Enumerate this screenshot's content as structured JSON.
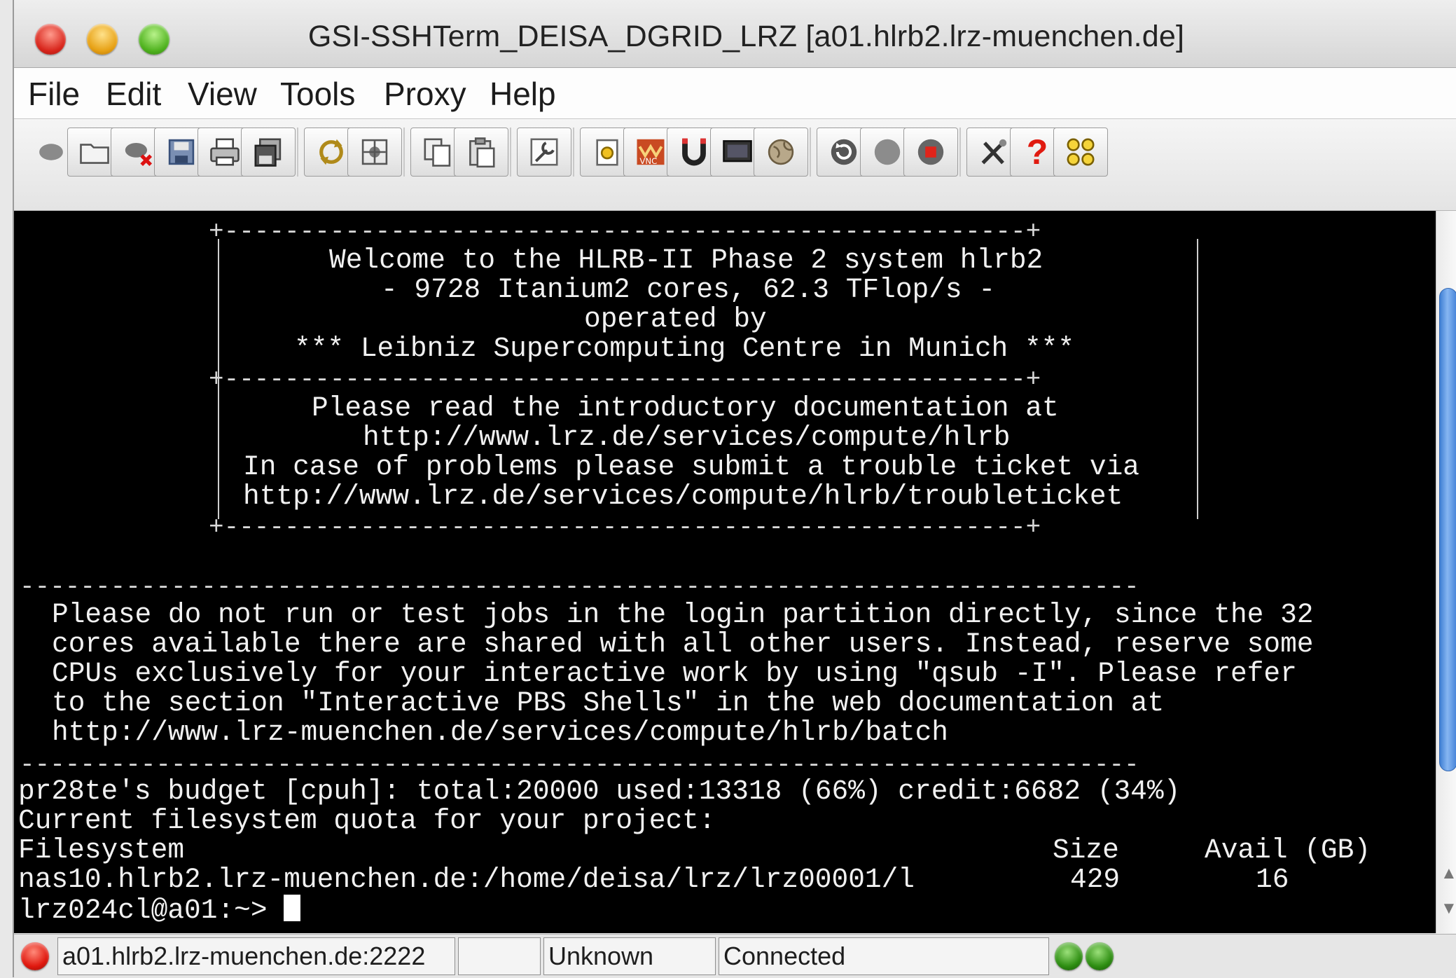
{
  "window": {
    "title": "GSI-SSHTerm_DEISA_DGRID_LRZ [a01.hlrb2.lrz-muenchen.de]"
  },
  "menu": [
    "File",
    "Edit",
    "View",
    "Tools",
    "Proxy",
    "Help"
  ],
  "toolbar": {
    "icons": [
      "connect-icon",
      "open-folder-icon",
      "disconnect-icon",
      "save-icon",
      "print-icon",
      "save-as-icon",
      "refresh-icon",
      "settings-frame-icon",
      "copy-icon",
      "paste-icon",
      "edit-wrench-icon",
      "certificate-lock-icon",
      "vnc-icon",
      "magnet-icon",
      "monitor-icon",
      "globe-icon",
      "reconnect-icon",
      "stop-icon",
      "record-icon",
      "tools-icon",
      "help-icon",
      "network-icon"
    ],
    "help_glyph": "?"
  },
  "terminal": {
    "banner": [
      "Welcome to the HLRB-II Phase 2 system hlrb2",
      "- 9728 Itanium2 cores, 62.3 TFlop/s -",
      "operated by",
      "*** Leibniz Supercomputing Centre in Munich ***"
    ],
    "info": [
      "Please read the introductory documentation at",
      "http://www.lrz.de/services/compute/hlrb",
      "In case of problems please submit a trouble ticket via",
      "http://www.lrz.de/services/compute/hlrb/troubleticket"
    ],
    "dashes": "--------------------------------------------------------------------------",
    "box_border": "+-----------------------------------------------------+",
    "notice": [
      "Please do not run or test jobs in the login partition directly, since the 32",
      "cores available there are shared with all other users. Instead, reserve some",
      "CPUs exclusively for your interactive work by using \"qsub -I\". Please refer",
      "to the section \"Interactive PBS Shells\" in the web documentation at",
      "http://www.lrz-muenchen.de/services/compute/hlrb/batch"
    ],
    "budget": "pr28te's budget [cpuh]: total:20000 used:13318 (66%) credit:6682 (34%)",
    "quota_title": "Current filesystem quota for your project:",
    "quota_header": {
      "filesystem": "Filesystem",
      "size": "Size",
      "avail": "Avail (GB)"
    },
    "quota_row": {
      "filesystem": "nas10.hlrb2.lrz-muenchen.de:/home/deisa/lrz/lrz00001/l",
      "size": "429",
      "avail": "16"
    },
    "prompt": "lrz024cl@a01:~> "
  },
  "status": {
    "host": "a01.hlrb2.lrz-muenchen.de:2222",
    "empty": "",
    "state": "Unknown",
    "connection": "Connected"
  },
  "colors": {
    "status_error": "#e0190f",
    "status_ok": "#2e8e12",
    "scroll_thumb": "#4a86d8"
  }
}
